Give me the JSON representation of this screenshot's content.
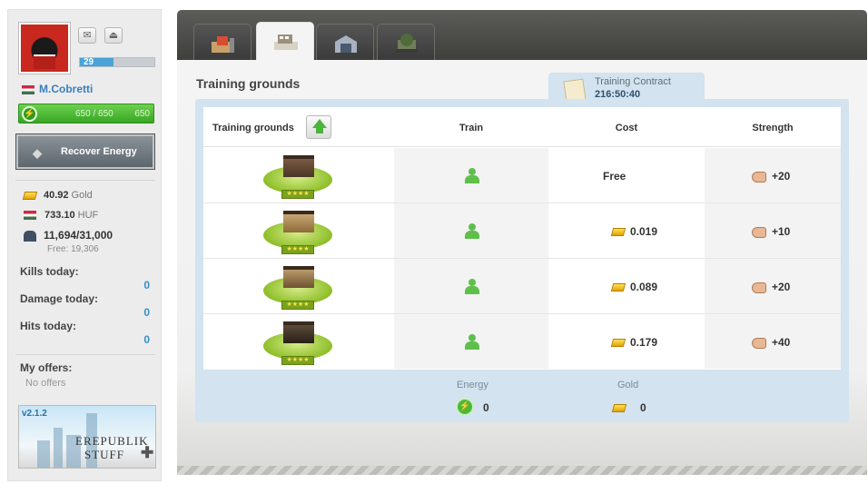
{
  "sidebar": {
    "level": "29",
    "level_progress": 0.45,
    "username": "M.Cobretti",
    "energy": {
      "text": "650 / 650",
      "max": "650",
      "fill": 1.0
    },
    "recover_energy_label": "Recover Energy",
    "currencies": [
      {
        "value": "40.92",
        "unit": "Gold",
        "icon": "gold-icon"
      },
      {
        "value": "733.10",
        "unit": "HUF",
        "icon": "hungary-flag-icon"
      },
      {
        "value": "11,694/31,000",
        "unit": "",
        "icon": "storage-icon"
      }
    ],
    "storage_free": "Free: 19,306",
    "stats": [
      {
        "label": "Kills today:",
        "value": "0"
      },
      {
        "label": "Damage today:",
        "value": "0"
      },
      {
        "label": "Hits today:",
        "value": "0"
      }
    ],
    "offers_label": "My offers:",
    "offers_value": "No offers",
    "banner": {
      "version": "v2.1.2",
      "line1": "EREPUBLIK",
      "line2": "STUFF"
    }
  },
  "main": {
    "tabs": [
      {
        "name": "companies-tab",
        "icon": "factory-icon"
      },
      {
        "name": "training-tab",
        "icon": "training-ground-icon",
        "active": true
      },
      {
        "name": "storage-tab",
        "icon": "warehouse-icon"
      },
      {
        "name": "military-tab",
        "icon": "military-depot-icon"
      }
    ],
    "heading": "Training grounds",
    "contract": {
      "label": "Training Contract",
      "value": "216:50:40"
    },
    "table": {
      "headers": {
        "grounds": "Training grounds",
        "train": "Train",
        "cost": "Cost",
        "strength": "Strength"
      },
      "rows": [
        {
          "cost": "Free",
          "gold": false,
          "strength": "+20"
        },
        {
          "cost": "0.019",
          "gold": true,
          "strength": "+10"
        },
        {
          "cost": "0.089",
          "gold": true,
          "strength": "+20"
        },
        {
          "cost": "0.179",
          "gold": true,
          "strength": "+40"
        }
      ]
    },
    "totals": {
      "energy_label": "Energy",
      "energy_value": "0",
      "gold_label": "Gold",
      "gold_value": "0"
    }
  },
  "colors": {
    "accent_blue": "#3a7ebf",
    "energy_green": "#4cb83a",
    "panel_blue": "#d3e3ef"
  }
}
